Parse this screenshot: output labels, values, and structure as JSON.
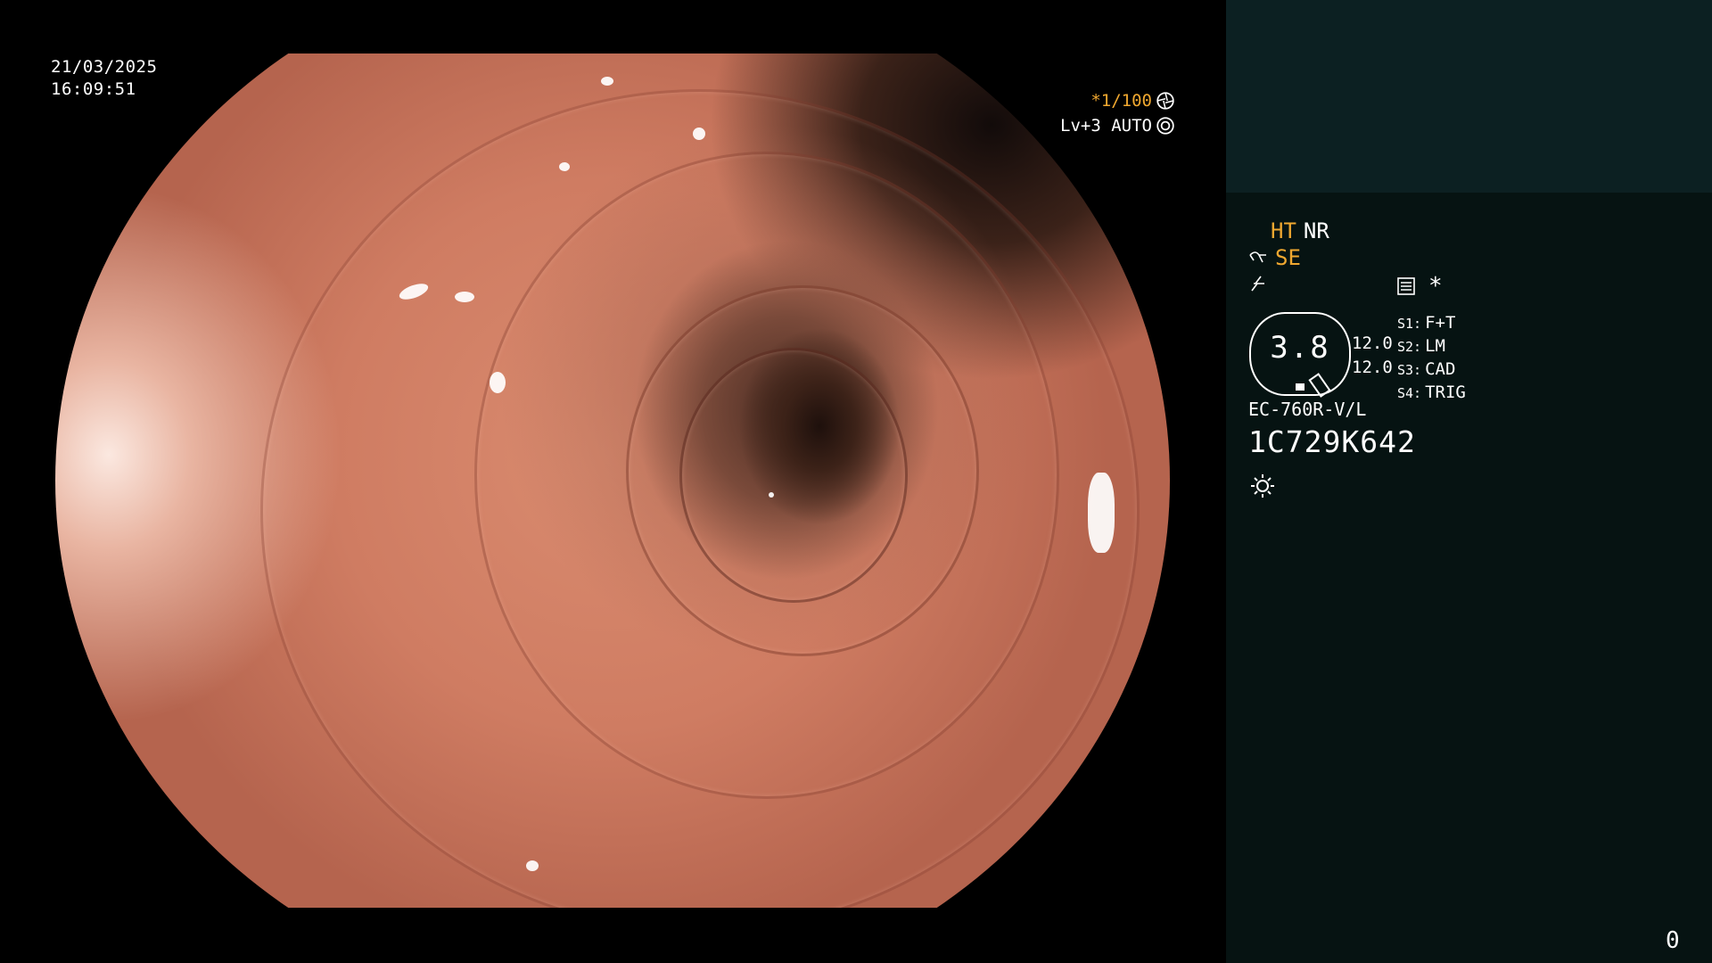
{
  "overlay": {
    "date": "21/03/2025",
    "time": "16:09:51",
    "shutter_speed": "*1/100",
    "iris_mode": "Lv+3 AUTO"
  },
  "panel": {
    "mode_ht": "HT",
    "mode_nr": "NR",
    "mode_se": "SE",
    "star": "*",
    "gauge_value": "3.8",
    "values": [
      "12.0",
      "12.0"
    ],
    "scope_buttons": [
      {
        "key": "S1:",
        "label": "F+T"
      },
      {
        "key": "S2:",
        "label": "LM"
      },
      {
        "key": "S3:",
        "label": "CAD"
      },
      {
        "key": "S4:",
        "label": "TRIG"
      }
    ],
    "model": "EC-760R-V/L",
    "serial": "1C729K642",
    "counter": "0"
  },
  "colors": {
    "accent_orange": "#f0a830",
    "panel_bg": "#061312",
    "panel_top_bg": "#0c2022"
  },
  "icons": [
    "shutter-icon",
    "iris-icon",
    "scissors-icon",
    "lightning-icon",
    "settings-list-icon",
    "sun-icon"
  ]
}
